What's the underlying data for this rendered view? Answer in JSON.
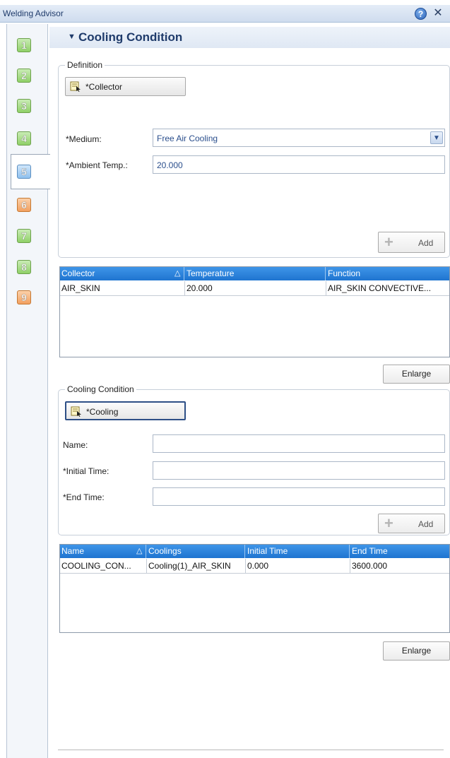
{
  "window": {
    "title": "Welding Advisor"
  },
  "steps": [
    "1",
    "2",
    "3",
    "4",
    "5",
    "6",
    "7",
    "8",
    "9"
  ],
  "section": {
    "title": "Cooling Condition"
  },
  "definition": {
    "group_title": "Definition",
    "collector_button": "*Collector",
    "medium_label": "*Medium:",
    "medium_value": "Free Air Cooling",
    "ambient_label": "*Ambient Temp.:",
    "ambient_value": "20.000",
    "add_label": "Add"
  },
  "collector_table": {
    "columns": [
      "Collector",
      "Temperature",
      "Function"
    ],
    "rows": [
      [
        "AIR_SKIN",
        "20.000",
        "AIR_SKIN CONVECTIVE..."
      ]
    ],
    "enlarge_label": "Enlarge"
  },
  "cooling": {
    "group_title": "Cooling Condition",
    "cooling_button": "*Cooling",
    "name_label": "Name:",
    "initial_label": "*Initial Time:",
    "end_label": "*End Time:",
    "name_value": "",
    "initial_value": "",
    "end_value": "",
    "add_label": "Add"
  },
  "cooling_table": {
    "columns": [
      "Name",
      "Coolings",
      "Initial Time",
      "End Time"
    ],
    "rows": [
      [
        "COOLING_CON...",
        "Cooling(1)_AIR_SKIN",
        "0.000",
        "3600.000"
      ]
    ],
    "enlarge_label": "Enlarge"
  },
  "colors": {
    "header_blue": "#1f74d0",
    "step_green": "#8fd067",
    "step_blue": "#8fc1ef",
    "step_orange": "#f2a060"
  }
}
